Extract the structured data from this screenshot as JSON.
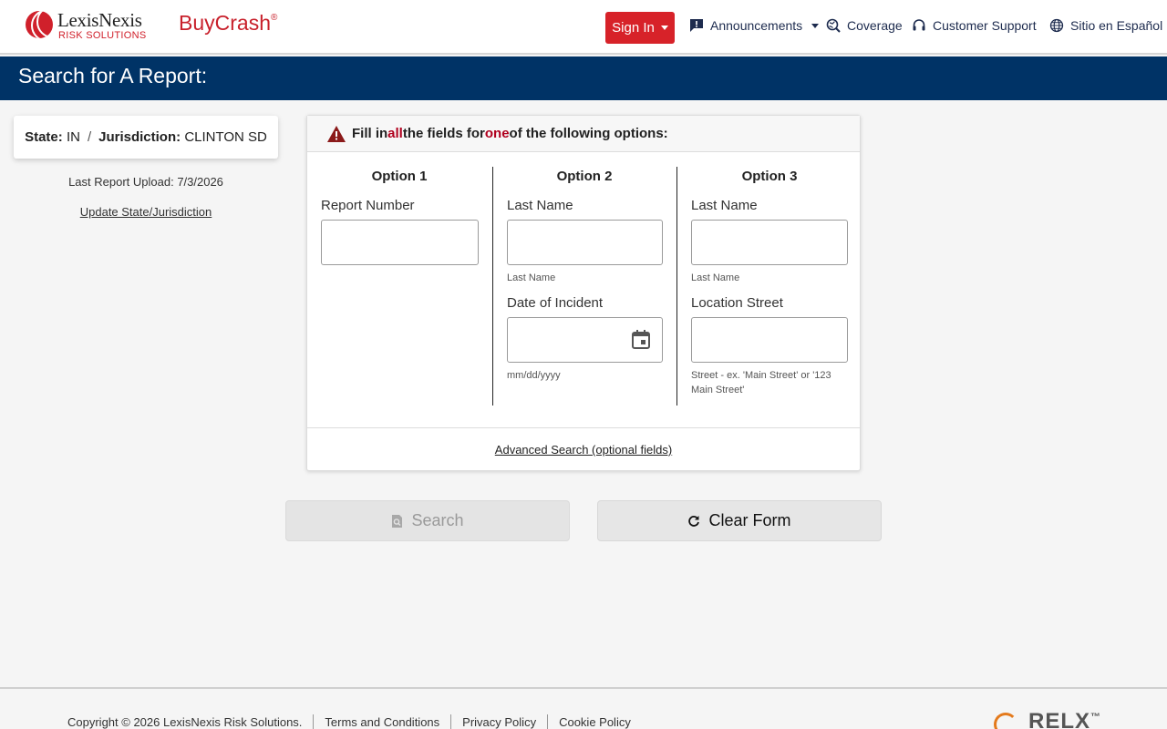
{
  "header": {
    "logo": {
      "name": "LexisNexis",
      "sub": "RISK SOLUTIONS"
    },
    "brand": "BuyCrash",
    "signin_label": "Sign In",
    "nav": [
      {
        "label": "Announcements",
        "icon": "announcement-icon"
      },
      {
        "label": "Coverage",
        "icon": "coverage-icon"
      },
      {
        "label": "Customer Support",
        "icon": "headset-icon"
      },
      {
        "label": "Sitio en Español",
        "icon": "globe-icon"
      }
    ]
  },
  "page_title": "Search for A Report:",
  "location": {
    "state_label": "State:",
    "state_value": "IN",
    "jurisdiction_label": "Jurisdiction:",
    "jurisdiction_value": "CLINTON SD",
    "last_upload": "Last Report Upload: 7/3/2026",
    "update_link": "Update State/Jurisdiction"
  },
  "form": {
    "instruction": {
      "part1": "Fill in ",
      "em1": "all",
      "part2": " the fields for ",
      "em2": "one",
      "part3": " of the following options:"
    },
    "option1": {
      "title": "Option 1",
      "report_number_label": "Report Number"
    },
    "option2": {
      "title": "Option 2",
      "last_name_label": "Last Name",
      "last_name_hint": "Last Name",
      "date_label": "Date of Incident",
      "date_hint": "mm/dd/yyyy"
    },
    "option3": {
      "title": "Option 3",
      "last_name_label": "Last Name",
      "last_name_hint": "Last Name",
      "street_label": "Location Street",
      "street_hint": "Street - ex. 'Main Street' or '123 Main Street'"
    },
    "advanced_link": "Advanced Search (optional fields)"
  },
  "buttons": {
    "search_label": "Search",
    "clear_label": "Clear Form"
  },
  "footer": {
    "copyright": "Copyright © 2026 LexisNexis Risk Solutions.",
    "links": [
      "Terms and Conditions",
      "Privacy Policy",
      "Cookie Policy"
    ],
    "relx": "RELX"
  },
  "colors": {
    "navy": "#003366",
    "brand_red": "#c8202b",
    "signin_red": "#d72229",
    "emphasis_red": "#b0001e",
    "relx_orange": "#e47a1c"
  }
}
